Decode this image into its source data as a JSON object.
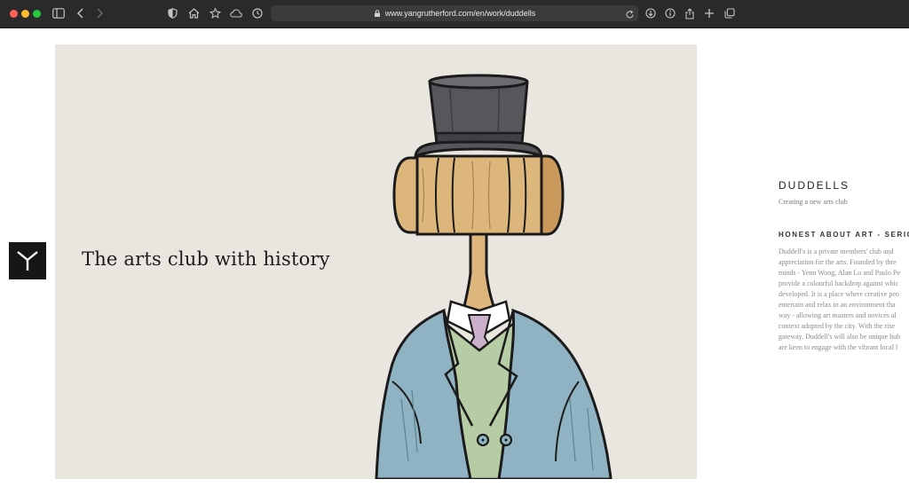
{
  "browser": {
    "url": "www.yangrutherford.com/en/work/duddells",
    "icons": [
      "sidebar-icon",
      "back-icon",
      "forward-icon",
      "shield-icon",
      "home-icon",
      "star-icon",
      "cloud-icon",
      "history-icon",
      "lock-icon",
      "reload-icon",
      "download-icon",
      "info-icon",
      "share-icon",
      "new-tab-icon",
      "tabs-overview-icon"
    ]
  },
  "site": {
    "logo_icon": "y-logo-icon"
  },
  "hero": {
    "headline": "The arts club with history"
  },
  "project": {
    "title": "DUDDELLS",
    "subtitle": "Creating a new arts club",
    "section_heading": "HONEST ABOUT ART - SERIOU",
    "body_lines": [
      "Duddell's  is a private members' club and",
      "appreciation for the arts. Founded by thre",
      "minds - Yenn Wong, Alan Lo and Paulo Pe",
      "provide a colourful backdrop against whic",
      "developed. It is a place where creative peo",
      "entertain and relax in an environment tha",
      "way - allowing art masters and novices al",
      "context adopted by the city. With the rise",
      "gateway, Duddell's will also be unique hub",
      "are keen to engage with the vibrant local l"
    ]
  },
  "colors": {
    "chrome_bg": "#2a2a2c",
    "hero_bg": "#e9e6df",
    "logo_tile_bg": "#161616",
    "suit_blue": "#8fb3c2",
    "gavel_wood": "#ddb67c",
    "hat_grey": "#55575b"
  }
}
